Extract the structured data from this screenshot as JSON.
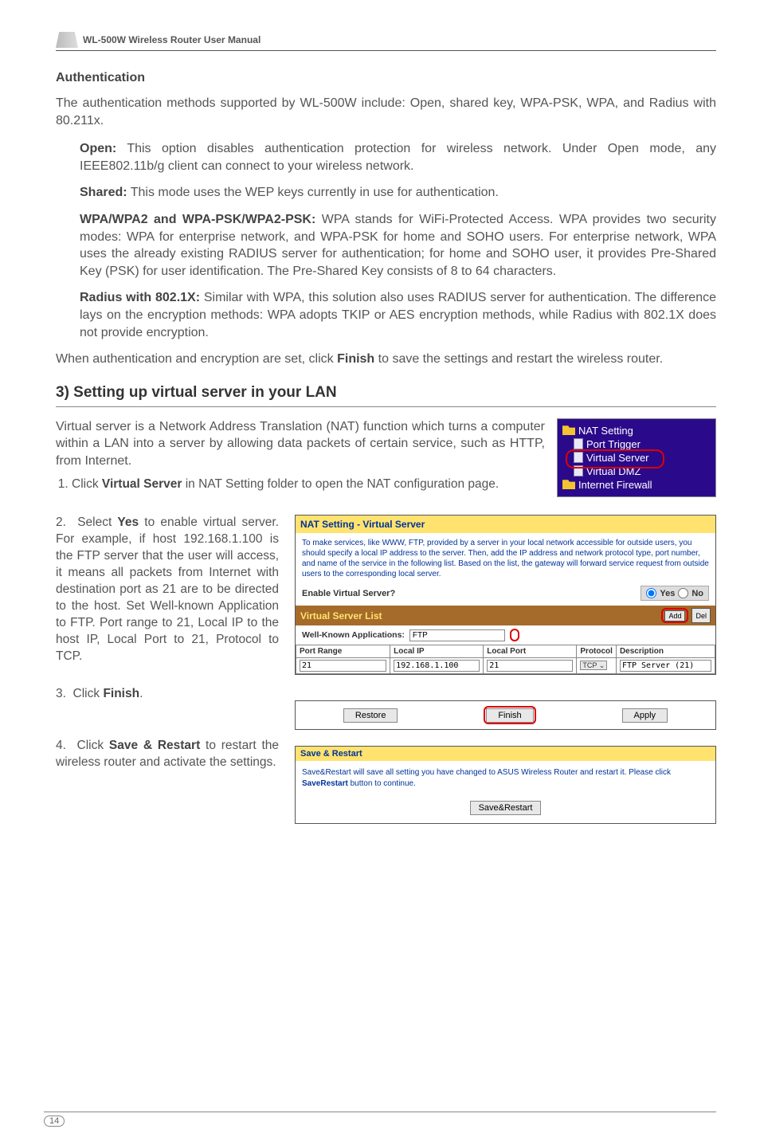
{
  "header": {
    "title": "WL-500W Wireless Router User Manual"
  },
  "auth": {
    "heading": "Authentication",
    "intro": "The authentication methods supported by WL-500W include: Open, shared key, WPA-PSK, WPA, and Radius with 80.211x.",
    "open_label": "Open:",
    "open_text": " This option disables authentication protection for wireless network. Under Open mode, any IEEE802.11b/g client can connect to your wireless network.",
    "shared_label": "Shared:",
    "shared_text": " This mode uses the WEP keys currently in use for authentication.",
    "wpa_label": "WPA/WPA2 and WPA-PSK/WPA2-PSK:",
    "wpa_text": " WPA stands for WiFi-Protected Access. WPA provides two security modes: WPA for enterprise network, and WPA-PSK for home and SOHO users. For enterprise network, WPA uses the already existing RADIUS server for authentication; for home and SOHO user, it provides Pre-Shared Key (PSK) for user identification. The Pre-Shared Key consists of 8 to 64 characters.",
    "radius_label": "Radius with 802.1X:",
    "radius_text": " Similar with WPA, this solution also uses RADIUS server for authentication. The difference lays on the encryption methods: WPA adopts TKIP or AES encryption methods, while Radius with 802.1X does not provide encryption.",
    "closing_pre": "When authentication and encryption are set, click ",
    "closing_bold": "Finish",
    "closing_post": " to save the settings and restart the wireless router."
  },
  "section3": {
    "heading": "3) Setting up virtual server in your LAN",
    "intro": "Virtual server is a Network Address Translation (NAT) function which turns a computer within a LAN into a server by allowing data packets of certain service, such as HTTP, from Internet.",
    "step1_pre": "Click ",
    "step1_bold": "Virtual Server",
    "step1_post": " in NAT Setting folder to open the NAT configuration page.",
    "step2_pre": "Select ",
    "step2_bold": "Yes",
    "step2_post": " to enable virtual server. For example, if host 192.168.1.100 is the FTP server that the user will access, it means all packets from Internet with destination port as 21 are to be directed to the host. Set Well-known Application to FTP. Port range to 21, Local IP to the host IP, Local Port to 21, Protocol to TCP.",
    "step3_pre": "Click ",
    "step3_bold": "Finish",
    "step3_post": ".",
    "step4_pre": "Click ",
    "step4_bold": "Save & Restart",
    "step4_post": " to restart the wireless router and activate the settings."
  },
  "nav": {
    "nat": "NAT Setting",
    "pt": "Port Trigger",
    "vs": "Virtual Server",
    "vd": "Virtual DMZ",
    "fw": "Internet Firewall"
  },
  "nat_panel": {
    "title": "NAT Setting - Virtual Server",
    "desc": "To make services, like WWW, FTP, provided by a server in your local network accessible for outside users, you should specify a local IP address to the server. Then, add the IP address and network protocol type, port number, and name of the service in the following list. Based on the list, the gateway will forward service request from outside users to the corresponding local server.",
    "enable_label": "Enable Virtual Server?",
    "yes": "Yes",
    "no": "No",
    "vs_header": "Virtual Server List",
    "add": "Add",
    "del": "Del",
    "wka": "Well-Known Applications:",
    "wka_value": "FTP",
    "th_pr": "Port Range",
    "th_lip": "Local IP",
    "th_lp": "Local Port",
    "th_proto": "Protocol",
    "th_desc": "Description",
    "row_pr": "21",
    "row_lip": "192.168.1.100",
    "row_lp": "21",
    "row_proto": "TCP",
    "row_desc": "FTP Server (21)"
  },
  "rfa": {
    "restore": "Restore",
    "finish": "Finish",
    "apply": "Apply"
  },
  "sr": {
    "title": "Save & Restart",
    "body_pre": "Save&Restart will save all setting you have changed to ASUS Wireless Router and restart it. Please click ",
    "body_bold": "SaveRestart",
    "body_post": " button to continue.",
    "button": "Save&Restart"
  },
  "page_number": "14"
}
